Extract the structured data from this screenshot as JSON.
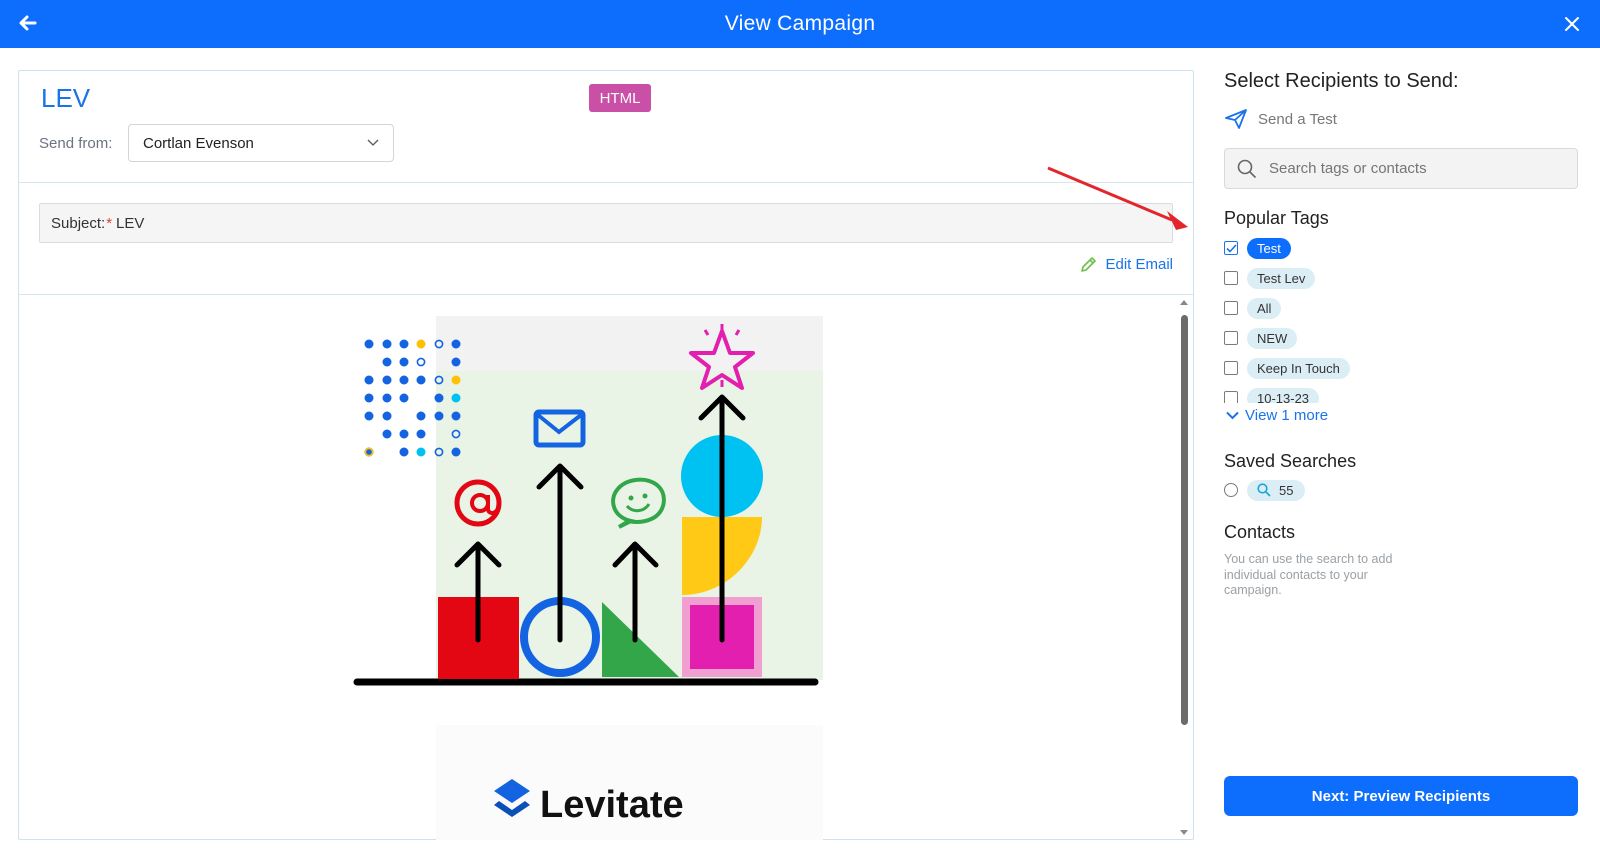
{
  "header": {
    "title": "View Campaign"
  },
  "campaign": {
    "name": "LEV",
    "format_badge": "HTML",
    "send_from_label": "Send from:",
    "sender": "Cortlan Evenson",
    "subject_label": "Subject:",
    "subject_required_mark": "*",
    "subject_value": "LEV",
    "edit_email_label": "Edit Email"
  },
  "preview": {
    "logo_text": "Levitate"
  },
  "recipients": {
    "title": "Select Recipients to Send:",
    "send_test_label": "Send a Test",
    "search_placeholder": "Search tags or contacts",
    "popular_tags_title": "Popular Tags",
    "tags": [
      {
        "label": "Test",
        "checked": true
      },
      {
        "label": "Test Lev",
        "checked": false
      },
      {
        "label": "All",
        "checked": false
      },
      {
        "label": "NEW",
        "checked": false
      },
      {
        "label": "Keep In Touch",
        "checked": false
      },
      {
        "label": "10-13-23",
        "checked": false
      }
    ],
    "view_more_label": "View 1 more",
    "saved_searches_title": "Saved Searches",
    "saved_searches": [
      {
        "label": "55",
        "selected": false
      }
    ],
    "contacts_title": "Contacts",
    "contacts_help": "You can use the search to add individual contacts to your campaign.",
    "next_button": "Next: Preview Recipients"
  },
  "colors": {
    "header_bg": "#0d6efd",
    "accent": "#1a73e8",
    "badge_bg": "#c94fa7",
    "annotation": "#e3262b"
  }
}
